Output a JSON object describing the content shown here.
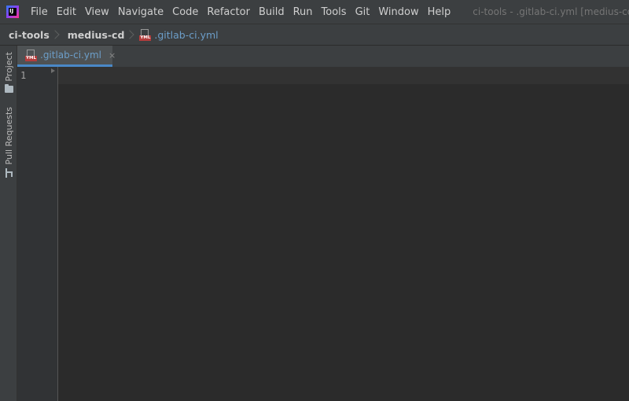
{
  "menubar": {
    "items": [
      "File",
      "Edit",
      "View",
      "Navigate",
      "Code",
      "Refactor",
      "Build",
      "Run",
      "Tools",
      "Git",
      "Window",
      "Help"
    ],
    "window_title": "ci-tools - .gitlab-ci.yml [medius-cd]"
  },
  "breadcrumb": {
    "project": "ci-tools",
    "module": "medius-cd",
    "file": ".gitlab-ci.yml",
    "file_icon_text": "YML"
  },
  "toolstrip": {
    "project_label": "Project",
    "pull_requests_label": "Pull Requests"
  },
  "tabs": [
    {
      "label": ".gitlab-ci.yml",
      "icon_text": "YML",
      "close": "×"
    }
  ],
  "editor": {
    "line_numbers": [
      "1"
    ]
  },
  "colors": {
    "background": "#2b2b2b",
    "chrome": "#3c3f41",
    "file_link": "#6c9ec9",
    "active_tab_underline": "#4a88c7"
  }
}
